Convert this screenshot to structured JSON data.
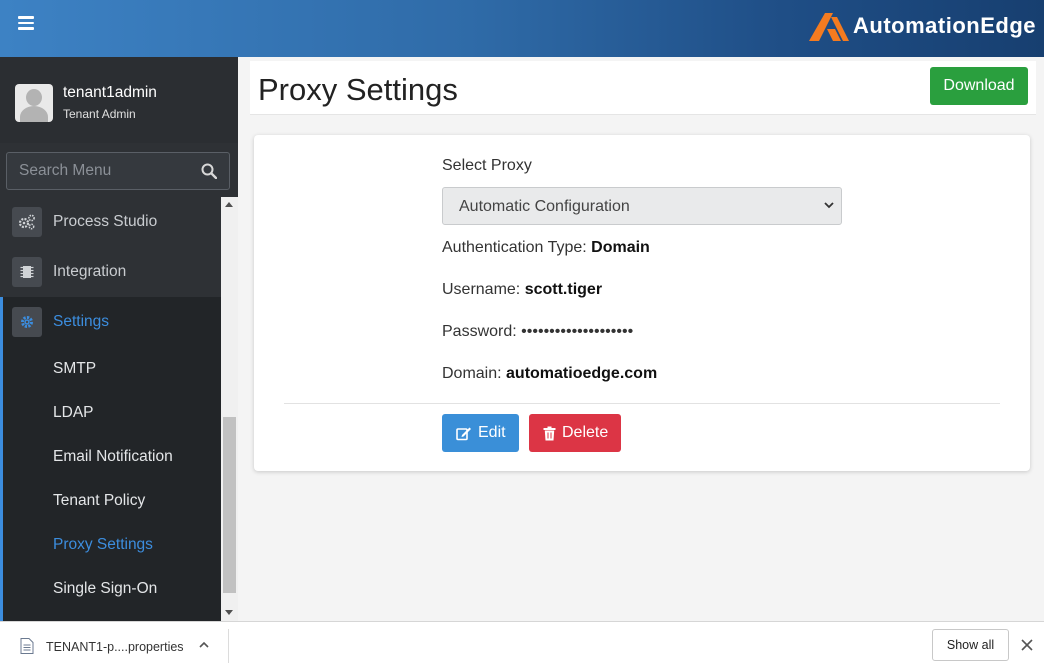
{
  "brand": {
    "name": "AutomationEdge",
    "logo_color": "#f47b20"
  },
  "user": {
    "name": "tenant1admin",
    "role": "Tenant Admin"
  },
  "search": {
    "placeholder": "Search Menu"
  },
  "menu": {
    "items": [
      {
        "label": "Process Studio",
        "icon": "gears-icon"
      },
      {
        "label": "Integration",
        "icon": "chip-icon"
      },
      {
        "label": "Settings",
        "icon": "gear-icon",
        "active": true
      }
    ],
    "sub_items": [
      {
        "label": "SMTP"
      },
      {
        "label": "LDAP"
      },
      {
        "label": "Email Notification"
      },
      {
        "label": "Tenant Policy"
      },
      {
        "label": "Proxy Settings",
        "active": true
      },
      {
        "label": "Single Sign-On"
      }
    ]
  },
  "page": {
    "title": "Proxy Settings",
    "download_label": "Download"
  },
  "form": {
    "select_label": "Select Proxy",
    "select_value": "Automatic Configuration",
    "auth_label": "Authentication Type:",
    "auth_value": "Domain",
    "username_label": "Username:",
    "username_value": "scott.tiger",
    "password_label": "Password:",
    "password_value": "••••••••••••••••••••",
    "domain_label": "Domain:",
    "domain_value": "automatioedge.com",
    "edit_label": "Edit",
    "delete_label": "Delete"
  },
  "download_bar": {
    "file_name": "TENANT1-p....properties",
    "show_all_label": "Show all"
  },
  "colors": {
    "accent": "#3c8dde",
    "success": "#2a9f3e",
    "danger": "#dc3545",
    "primary": "#3a8fd8"
  }
}
